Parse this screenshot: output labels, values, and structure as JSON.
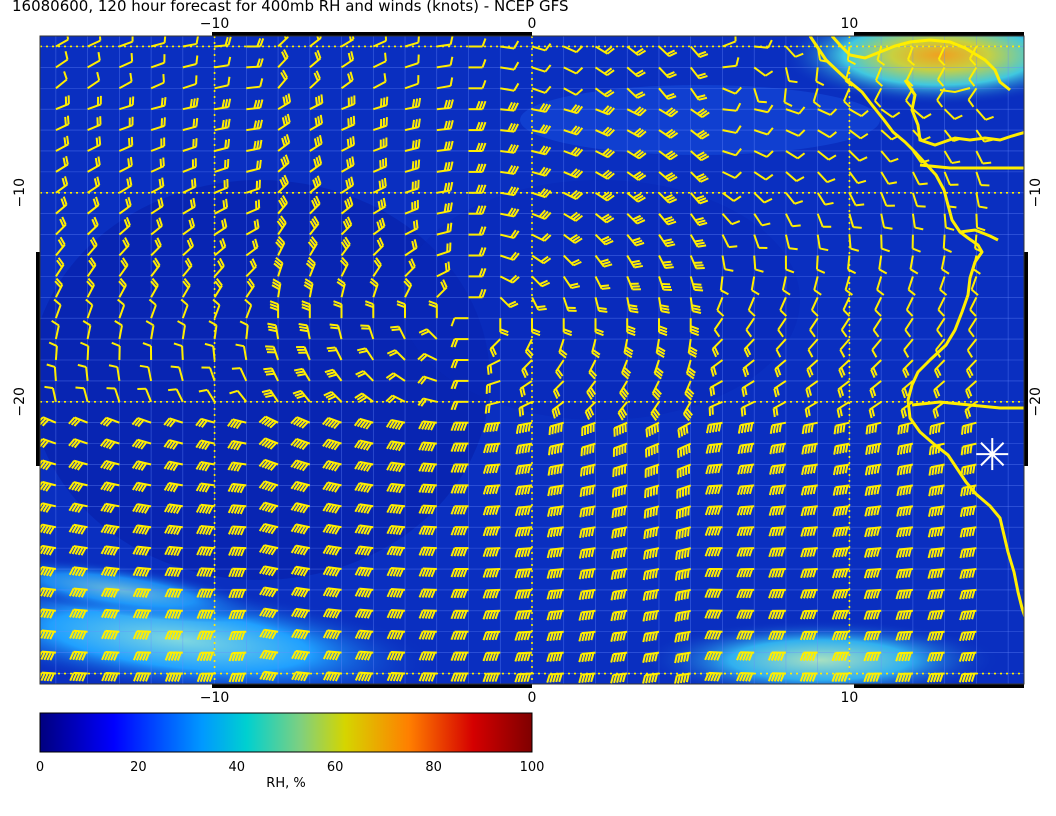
{
  "title": "16080600, 120 hour forecast for 400mb RH and winds (knots) - NCEP GFS",
  "map": {
    "lon_range": [
      -15.5,
      15.5
    ],
    "lat_range": [
      -33.5,
      -2.5
    ],
    "x_ticks": [
      -10,
      0,
      10
    ],
    "y_ticks": [
      -10,
      -20
    ],
    "x_tick_labels": [
      "−10",
      "0",
      "10"
    ],
    "y_tick_labels": [
      "−10",
      "−20"
    ],
    "background_color": "#0a2fc0",
    "barb_color": "#ffee00",
    "coast_color": "#ffee00",
    "marker": {
      "lon": 14.5,
      "lat": -22.5,
      "icon": "asterisk-marker-icon",
      "color": "#ffffff"
    }
  },
  "colorbar": {
    "min": 0,
    "max": 100,
    "ticks": [
      "0",
      "20",
      "40",
      "60",
      "80",
      "100"
    ],
    "label": "RH, %",
    "colors": [
      "#00007f",
      "#0000ff",
      "#007fff",
      "#00d5d5",
      "#7fd07f",
      "#d5d500",
      "#ff7f00",
      "#d50000",
      "#7f0000"
    ]
  }
}
